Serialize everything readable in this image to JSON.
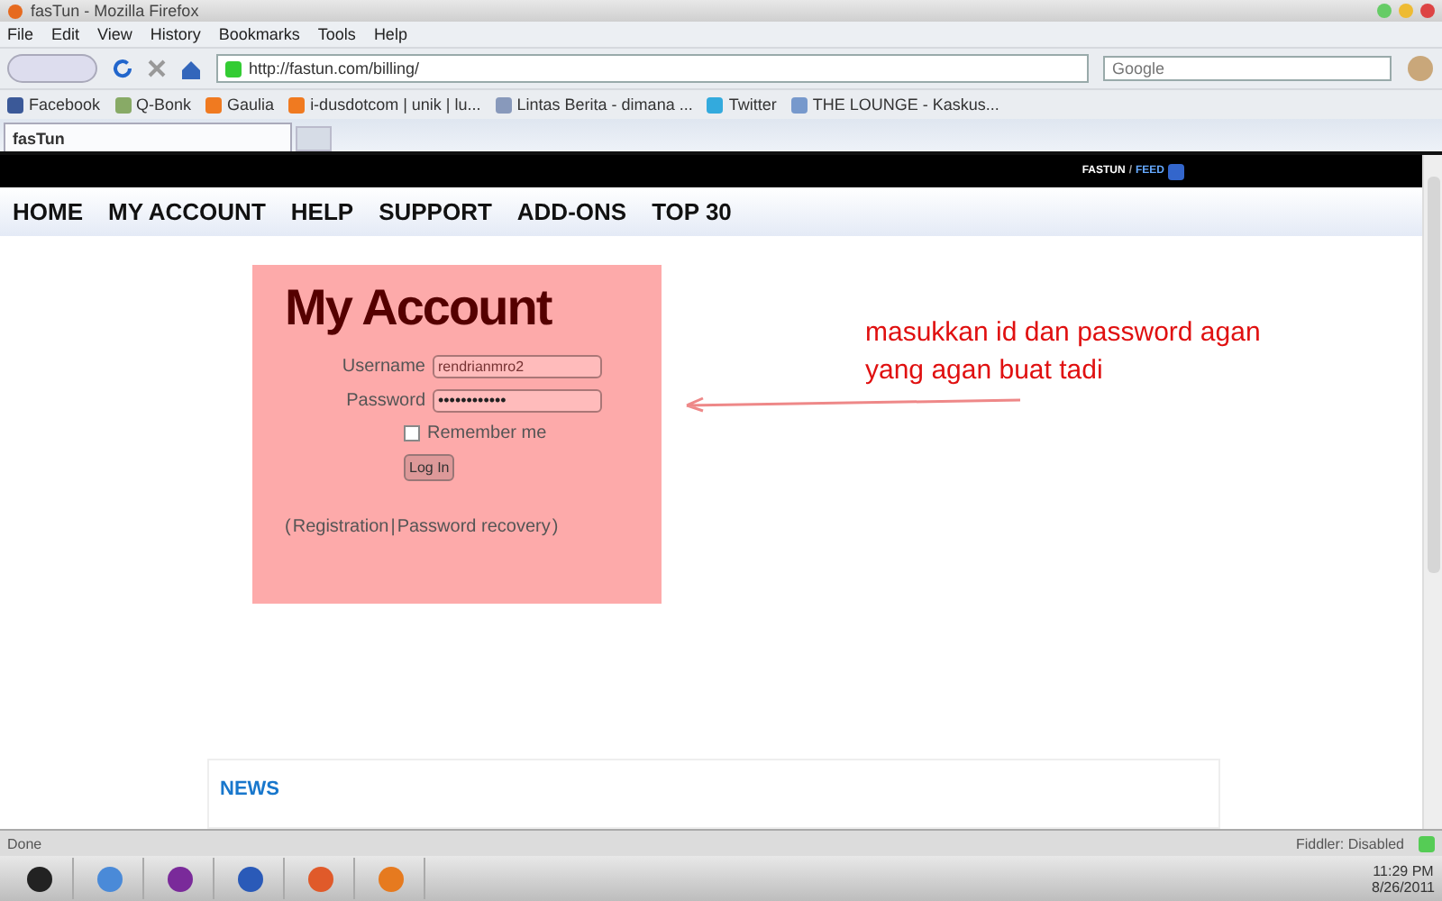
{
  "window": {
    "title": "fasTun - Mozilla Firefox"
  },
  "menu": [
    "File",
    "Edit",
    "View",
    "History",
    "Bookmarks",
    "Tools",
    "Help"
  ],
  "address": {
    "value": "http://fastun.com/billing/"
  },
  "search": {
    "placeholder": "Google"
  },
  "bookmarks": [
    {
      "label": "Facebook",
      "color": "#3b5998"
    },
    {
      "label": "Q-Bonk",
      "color": "#88aa66"
    },
    {
      "label": "Gaulia",
      "color": "#f07a20"
    },
    {
      "label": "i-dusdotcom | unik | lu...",
      "color": "#f07a20"
    },
    {
      "label": "Lintas Berita - dimana ...",
      "color": "#8899bb"
    },
    {
      "label": "Twitter",
      "color": "#33aadd"
    },
    {
      "label": "THE LOUNGE - Kaskus...",
      "color": "#7799cc"
    }
  ],
  "tabs": [
    {
      "label": "fasTun",
      "selected": true
    }
  ],
  "site": {
    "top_links": [
      "FASTUN",
      "/",
      "FEED"
    ],
    "nav": [
      "HOME",
      "MY ACCOUNT",
      "HELP",
      "SUPPORT",
      "ADD-ONS",
      "TOP 30"
    ],
    "login": {
      "title": "My Account",
      "username_label": "Username",
      "username": "rendrianmro2",
      "password_label": "Password",
      "password": "••••••••••••",
      "remember": {
        "label": "Remember me",
        "checked": false
      },
      "button": "Log In",
      "open": "(",
      "links": [
        "Registration",
        "Password recovery"
      ],
      "separator": "|",
      "close": ")"
    },
    "annotation": [
      "masukkan id dan password agan",
      "yang agan buat tadi"
    ],
    "news_title": "NEWS"
  },
  "status_bar": {
    "text": "Done",
    "fiddler": "Fiddler: Disabled"
  },
  "taskbar": {
    "time": "11:29 PM",
    "date": "8/26/2011"
  }
}
